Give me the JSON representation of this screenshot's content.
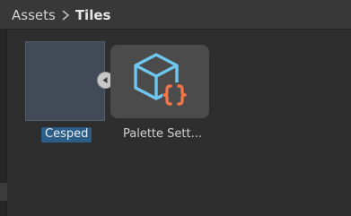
{
  "breadcrumb": {
    "parent": "Assets",
    "current": "Tiles"
  },
  "assets": [
    {
      "name": "Cesped",
      "selected": true,
      "icon": "tile-thumbnail"
    },
    {
      "name": "Palette Sett...",
      "selected": false,
      "icon": "scriptable-object-icon"
    }
  ],
  "colors": {
    "selection": "#2c5d87",
    "tile_swatch": "#414a56",
    "cube_outline": "#6fc7f0",
    "braces": "#f07548"
  }
}
